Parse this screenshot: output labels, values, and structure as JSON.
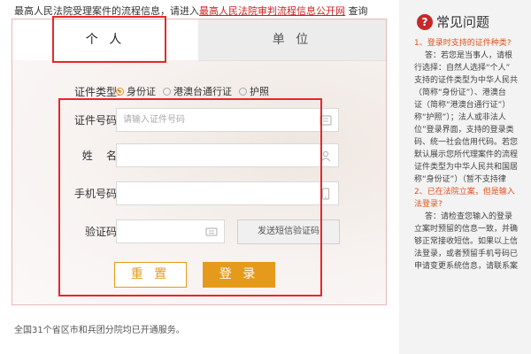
{
  "notice": {
    "prefix": "最高人民法院受理案件的流程信息，请进入",
    "link": "最高人民法院审判流程信息公开网",
    "suffix": "查询"
  },
  "tabs": {
    "personal": "个 人",
    "organization": "单 位"
  },
  "form": {
    "cert_type_label": "证件类型:",
    "cert_types": [
      "身份证",
      "港澳台通行证",
      "护照"
    ],
    "cert_type_selected": "身份证",
    "cert_no_label": "证件号码:",
    "cert_no_placeholder": "请输入证件号码",
    "name_label": "姓    名:",
    "phone_label": "手机号码:",
    "code_label": "验证码:",
    "sms_button": "发送短信验证码",
    "reset_button": "重 置",
    "login_button": "登 录"
  },
  "footer": {
    "coverage": "全国31个省区市和兵团分院均已开通服务。"
  },
  "faq": {
    "title": "常见问题",
    "lines": [
      {
        "text": "1、登录时支持的证件种类?",
        "q": true
      },
      {
        "text": "答：若您是当事人，请根",
        "q": false
      },
      {
        "text": "行选择：自然人选择“个人”",
        "q": false
      },
      {
        "text": "支持的证件类型为中华人民共",
        "q": false
      },
      {
        "text": "（简称“身份证”）、港澳台",
        "q": false
      },
      {
        "text": "证（简称“港澳台通行证”）",
        "q": false
      },
      {
        "text": "称“护照”）；法人或非法人",
        "q": false
      },
      {
        "text": "位”登录界面，支持的登录类",
        "q": false
      },
      {
        "text": "码、统一社会信用代码。若您",
        "q": false
      },
      {
        "text": "默认展示您所代理案件的流程",
        "q": false
      },
      {
        "text": "证件类型为中华人民共和国居",
        "q": false
      },
      {
        "text": "称“身份证”）（暂不支持律",
        "q": false
      },
      {
        "text": "2、已在法院立案，但是输入",
        "q": true
      },
      {
        "text": "法登录?",
        "q": true
      },
      {
        "text": "答：请检查您输入的登录",
        "q": false
      },
      {
        "text": "立案时预留的信息一致，并确",
        "q": false
      },
      {
        "text": "够正常接收短信。如果以上信",
        "q": false
      },
      {
        "text": "法登录，或者预留手机号码已",
        "q": false
      },
      {
        "text": "申请变更系统信息，请联系案",
        "q": false
      }
    ]
  },
  "colors": {
    "accent": "#e69a1d",
    "highlight": "#e8272a",
    "link": "#cc1f1f",
    "faq_question": "#e0531c"
  }
}
